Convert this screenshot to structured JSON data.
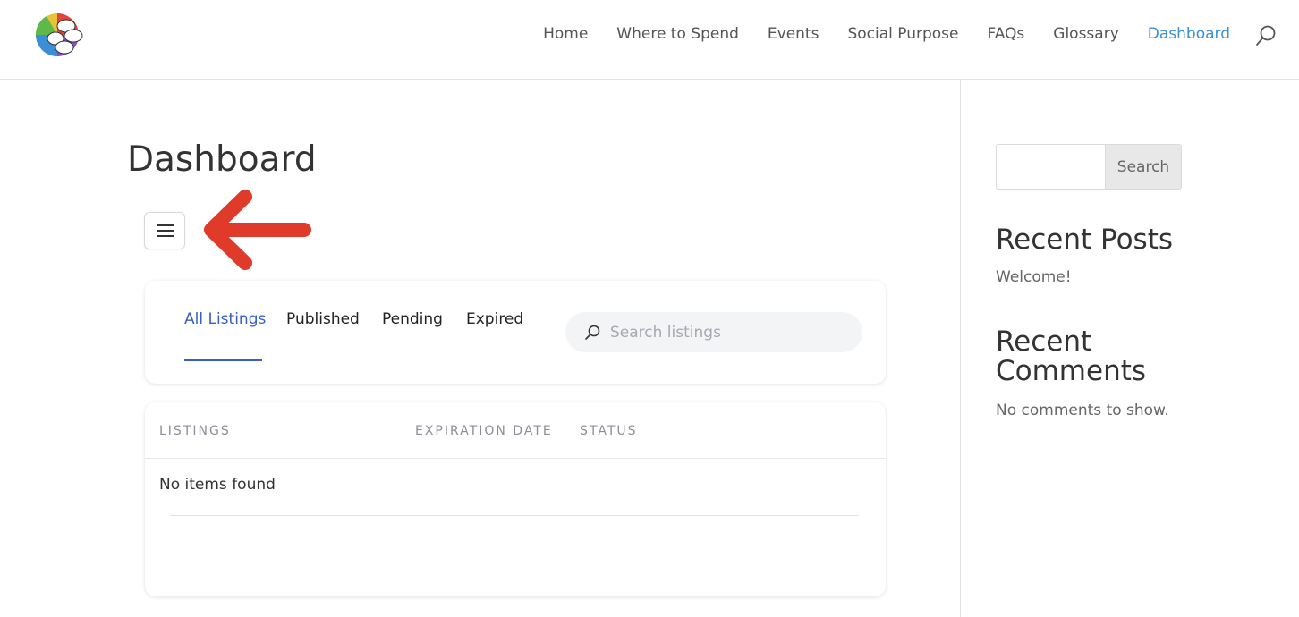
{
  "header": {
    "logo_icon": "colorful-circles-logo",
    "nav": [
      {
        "label": "Home"
      },
      {
        "label": "Where to Spend"
      },
      {
        "label": "Events"
      },
      {
        "label": "Social Purpose"
      },
      {
        "label": "FAQs"
      },
      {
        "label": "Glossary"
      },
      {
        "label": "Dashboard",
        "active": true
      }
    ],
    "search_icon": "search-icon",
    "active_color": "#3b8fd9"
  },
  "main": {
    "title": "Dashboard",
    "menu_toggle_icon": "hamburger-icon",
    "annotation_arrow_color": "#e03a2a",
    "tabs": [
      {
        "label": "All Listings",
        "active": true
      },
      {
        "label": "Published"
      },
      {
        "label": "Pending"
      },
      {
        "label": "Expired"
      }
    ],
    "search": {
      "placeholder": "Search listings",
      "value": ""
    },
    "table": {
      "columns": [
        "LISTINGS",
        "EXPIRATION DATE",
        "STATUS"
      ],
      "empty_message": "No items found"
    },
    "accent_color": "#3a5fc8"
  },
  "sidebar": {
    "search": {
      "value": "",
      "button_label": "Search"
    },
    "recent_posts": {
      "title": "Recent Posts",
      "items": [
        "Welcome!"
      ]
    },
    "recent_comments": {
      "title": "Recent Comments",
      "empty_message": "No comments to show."
    }
  }
}
